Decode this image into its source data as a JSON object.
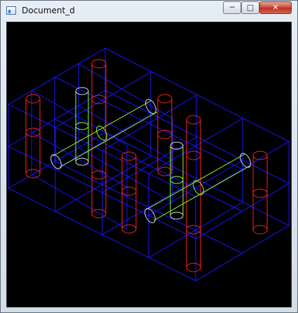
{
  "window": {
    "title": "Document_d"
  },
  "titlebar": {
    "minimize_glyph": "─",
    "maximize_glyph": "□",
    "close_glyph": "✕"
  }
}
